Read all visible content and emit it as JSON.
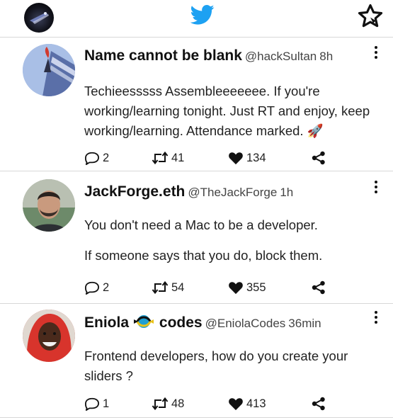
{
  "header": {
    "profile_icon": "user-avatar",
    "logo_icon": "twitter-bird-icon",
    "feature_icon": "star-icon",
    "brand_color": "#1DA1F2"
  },
  "tweets": [
    {
      "name": "Name cannot be blank",
      "handle": "@hackSultan",
      "time": "8h",
      "text": [
        "Techieesssss Assembleeeeeee. If you're working/learning tonight. Just RT and enjoy, keep working/learning. Attendance marked. 🚀"
      ],
      "replies": "2",
      "retweets": "41",
      "likes": "134"
    },
    {
      "name": "JackForge.eth",
      "handle": "@TheJackForge",
      "time": "1h",
      "text": [
        "You don't need a Mac to be a developer.",
        "If someone says that you do, block them."
      ],
      "replies": "2",
      "retweets": "54",
      "likes": "355"
    },
    {
      "name": "Eniola",
      "name_suffix": "codes",
      "handle": "@EniolaCodes",
      "time": "36min",
      "text": [
        "Frontend developers, how do you create your sliders ?"
      ],
      "replies": "1",
      "retweets": "48",
      "likes": "413"
    }
  ]
}
